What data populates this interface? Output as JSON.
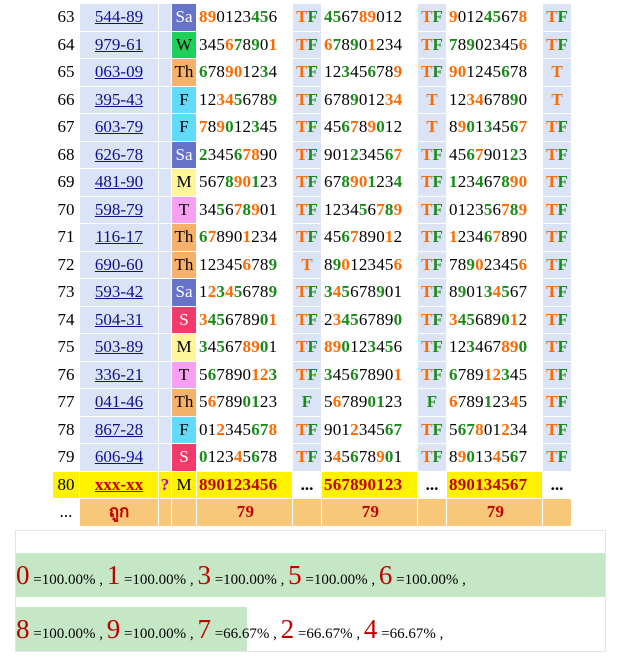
{
  "rows": [
    {
      "n": "63",
      "code": "544-89",
      "day": "Sa",
      "d1": "890123456",
      "t1": "TF",
      "d2": "456789012",
      "t2": "TF",
      "d3": "901245678",
      "t3": "TF"
    },
    {
      "n": "64",
      "code": "979-61",
      "day": "W",
      "d1": "345678901",
      "t1": "TF",
      "d2": "678901234",
      "t2": "TF",
      "d3": "789023456",
      "t3": "TF"
    },
    {
      "n": "65",
      "code": "063-09",
      "day": "Th",
      "d1": "678901234",
      "t1": "TF",
      "d2": "123456789",
      "t2": "TF",
      "d3": "901245678",
      "t3": "T"
    },
    {
      "n": "66",
      "code": "395-43",
      "day": "F",
      "d1": "123456789",
      "t1": "TF",
      "d2": "678901234",
      "t2": "T",
      "d3": "123467890",
      "t3": "T"
    },
    {
      "n": "67",
      "code": "603-79",
      "day": "F",
      "d1": "789012345",
      "t1": "TF",
      "d2": "456789012",
      "t2": "T",
      "d3": "890134567",
      "t3": "TF"
    },
    {
      "n": "68",
      "code": "626-78",
      "day": "Sa",
      "d1": "234567890",
      "t1": "TF",
      "d2": "901234567",
      "t2": "TF",
      "d3": "456790123",
      "t3": "TF"
    },
    {
      "n": "69",
      "code": "481-90",
      "day": "M",
      "d1": "567890123",
      "t1": "TF",
      "d2": "678901234",
      "t2": "TF",
      "d3": "123467890",
      "t3": "TF"
    },
    {
      "n": "70",
      "code": "598-79",
      "day": "T",
      "d1": "345678901",
      "t1": "TF",
      "d2": "123456789",
      "t2": "TF",
      "d3": "012356789",
      "t3": "TF"
    },
    {
      "n": "71",
      "code": "116-17",
      "day": "Th",
      "d1": "678901234",
      "t1": "TF",
      "d2": "456789012",
      "t2": "TF",
      "d3": "123467890",
      "t3": "TF"
    },
    {
      "n": "72",
      "code": "690-60",
      "day": "Th",
      "d1": "123456789",
      "t1": "T",
      "d2": "890123456",
      "t2": "TF",
      "d3": "789023456",
      "t3": "TF"
    },
    {
      "n": "73",
      "code": "593-42",
      "day": "Sa",
      "d1": "123456789",
      "t1": "TF",
      "d2": "345678901",
      "t2": "TF",
      "d3": "890134567",
      "t3": "TF"
    },
    {
      "n": "74",
      "code": "504-31",
      "day": "S",
      "d1": "345678901",
      "t1": "TF",
      "d2": "234567890",
      "t2": "TF",
      "d3": "345689012",
      "t3": "TF"
    },
    {
      "n": "75",
      "code": "503-89",
      "day": "M",
      "d1": "345678901",
      "t1": "TF",
      "d2": "890123456",
      "t2": "TF",
      "d3": "123467890",
      "t3": "TF"
    },
    {
      "n": "76",
      "code": "336-21",
      "day": "T",
      "d1": "567890123",
      "t1": "TF",
      "d2": "345678901",
      "t2": "TF",
      "d3": "678912345",
      "t3": "TF"
    },
    {
      "n": "77",
      "code": "041-46",
      "day": "Th",
      "d1": "567890123",
      "t1": "F",
      "d2": "567890123",
      "t2": "F",
      "d3": "678912345",
      "t3": "TF"
    },
    {
      "n": "78",
      "code": "867-28",
      "day": "F",
      "d1": "012345678",
      "t1": "TF",
      "d2": "901234567",
      "t2": "TF",
      "d3": "567801234",
      "t3": "TF"
    },
    {
      "n": "79",
      "code": "606-94",
      "day": "S",
      "d1": "012345678",
      "t1": "TF",
      "d2": "345678901",
      "t2": "TF",
      "d3": "890134567",
      "t3": "TF"
    }
  ],
  "pred": {
    "n": "80",
    "code": "xxx-xx",
    "q": "?",
    "day": "M",
    "d1": "890123456",
    "t1": "...",
    "d2": "567890123",
    "t2": "...",
    "d3": "890134567",
    "t3": "..."
  },
  "count_row": {
    "n": "...",
    "label": "ถูก",
    "v1": "79",
    "v2": "79",
    "v3": "79"
  },
  "stats_lines": [
    [
      {
        "d": "0",
        "p": "=100.00%"
      },
      {
        "d": "1",
        "p": "=100.00%"
      },
      {
        "d": "3",
        "p": "=100.00%"
      },
      {
        "d": "5",
        "p": "=100.00%"
      },
      {
        "d": "6",
        "p": "=100.00%"
      }
    ],
    [
      {
        "d": "8",
        "p": "=100.00%"
      },
      {
        "d": "9",
        "p": "=100.00%"
      },
      {
        "d": "7",
        "p": "=66.67%"
      },
      {
        "d": "2",
        "p": "=66.67%"
      },
      {
        "d": "4",
        "p": "=66.67%"
      }
    ]
  ],
  "colors": {
    "tf_T": "#ff6a00",
    "tf_F": "#1a8a1a",
    "highlight_bg": "#c6e7c6",
    "digit_red": "#c00000"
  }
}
